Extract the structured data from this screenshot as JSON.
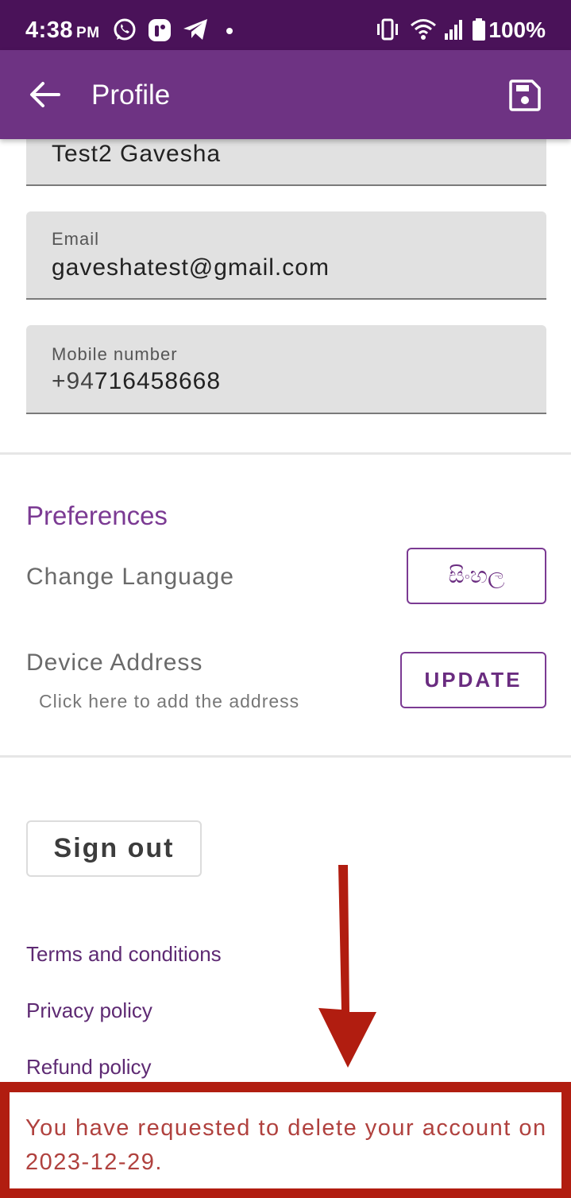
{
  "status_bar": {
    "time": "4:38",
    "ampm": "PM",
    "battery": "100%"
  },
  "app_bar": {
    "title": "Profile"
  },
  "fields": {
    "name": {
      "value": "Test2 Gavesha"
    },
    "email": {
      "label": "Email",
      "value": "gaveshatest@gmail.com"
    },
    "mobile": {
      "label": "Mobile number",
      "prefix": "+94",
      "value": "716458668"
    }
  },
  "preferences": {
    "title": "Preferences",
    "language_label": "Change Language",
    "language_button": "සිංහල",
    "address_label": "Device Address",
    "address_hint": "Click here to add the address",
    "update_button": "UPDATE"
  },
  "account": {
    "sign_out": "Sign out"
  },
  "links": {
    "terms": "Terms and conditions",
    "privacy": "Privacy policy",
    "refund": "Refund policy"
  },
  "notice": {
    "text": "You have requested to delete your account on 2023-12-29."
  },
  "colors": {
    "status_bar": "#4a1259",
    "app_bar": "#6e3383",
    "accent": "#7b3a93",
    "annotation_red": "#b11d10"
  }
}
